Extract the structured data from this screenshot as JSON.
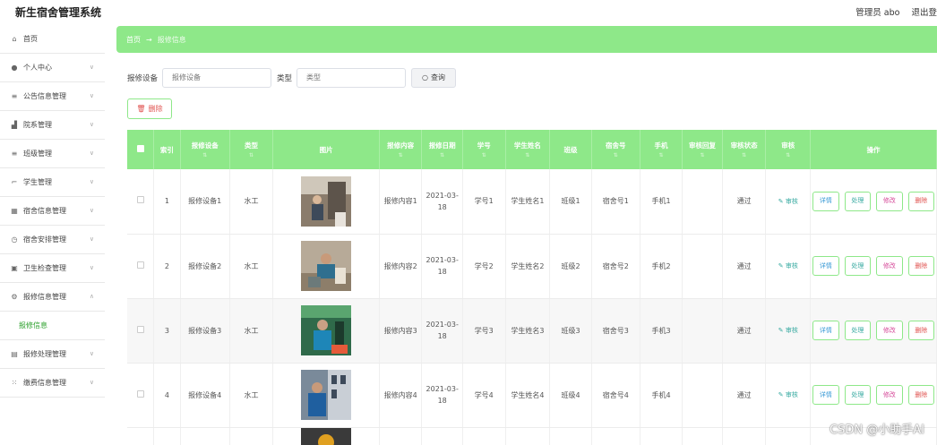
{
  "app": {
    "title": "新生宿舍管理系统",
    "admin_label": "管理员 abo",
    "logout_label": "退出登"
  },
  "sidebar": {
    "items": [
      {
        "icon": "home-icon",
        "label": "首页"
      },
      {
        "icon": "user-icon",
        "label": "个人中心"
      },
      {
        "icon": "list-icon",
        "label": "公告信息管理"
      },
      {
        "icon": "chart-icon",
        "label": "院系管理"
      },
      {
        "icon": "list-icon",
        "label": "班级管理"
      },
      {
        "icon": "crop-icon",
        "label": "学生管理"
      },
      {
        "icon": "grid-icon",
        "label": "宿舍信息管理"
      },
      {
        "icon": "clock-icon",
        "label": "宿舍安排管理"
      },
      {
        "icon": "photo-icon",
        "label": "卫生检查管理"
      },
      {
        "icon": "gear-icon",
        "label": "报修信息管理"
      },
      {
        "icon": "submenu",
        "label": "报修信息"
      },
      {
        "icon": "doc-icon",
        "label": "报修处理管理"
      },
      {
        "icon": "apps-icon",
        "label": "缴费信息管理"
      }
    ]
  },
  "breadcrumb": {
    "home": "首页",
    "arrow": "→",
    "current": "报修信息"
  },
  "search": {
    "device_label": "报修设备",
    "device_placeholder": "报修设备",
    "type_label": "类型",
    "type_placeholder": "类型",
    "button_label": "查询"
  },
  "delete_button_label": "删除",
  "table": {
    "headers": [
      "",
      "索引",
      "报修设备",
      "类型",
      "图片",
      "报修内容",
      "报修日期",
      "学号",
      "学生姓名",
      "班级",
      "宿舍号",
      "手机",
      "审核回复",
      "审核状态",
      "审核",
      "操作"
    ],
    "audit_label": "审核",
    "ops": {
      "detail": "详情",
      "handle": "处理",
      "edit": "修改",
      "delete": "删除"
    },
    "rows": [
      {
        "index": "1",
        "device": "报修设备1",
        "type": "水工",
        "content": "报修内容1",
        "date": "2021-03-18",
        "sno": "学号1",
        "sname": "学生姓名1",
        "class": "班级1",
        "dorm": "宿舍号1",
        "phone": "手机1",
        "reply": "",
        "status": "通过"
      },
      {
        "index": "2",
        "device": "报修设备2",
        "type": "水工",
        "content": "报修内容2",
        "date": "2021-03-18",
        "sno": "学号2",
        "sname": "学生姓名2",
        "class": "班级2",
        "dorm": "宿舍号2",
        "phone": "手机2",
        "reply": "",
        "status": "通过"
      },
      {
        "index": "3",
        "device": "报修设备3",
        "type": "水工",
        "content": "报修内容3",
        "date": "2021-03-18",
        "sno": "学号3",
        "sname": "学生姓名3",
        "class": "班级3",
        "dorm": "宿舍号3",
        "phone": "手机3",
        "reply": "",
        "status": "通过"
      },
      {
        "index": "4",
        "device": "报修设备4",
        "type": "水工",
        "content": "报修内容4",
        "date": "2021-03-18",
        "sno": "学号4",
        "sname": "学生姓名4",
        "class": "班级4",
        "dorm": "宿舍号4",
        "phone": "手机4",
        "reply": "",
        "status": "通过"
      }
    ]
  },
  "watermark": "CSDN @小助手AI"
}
